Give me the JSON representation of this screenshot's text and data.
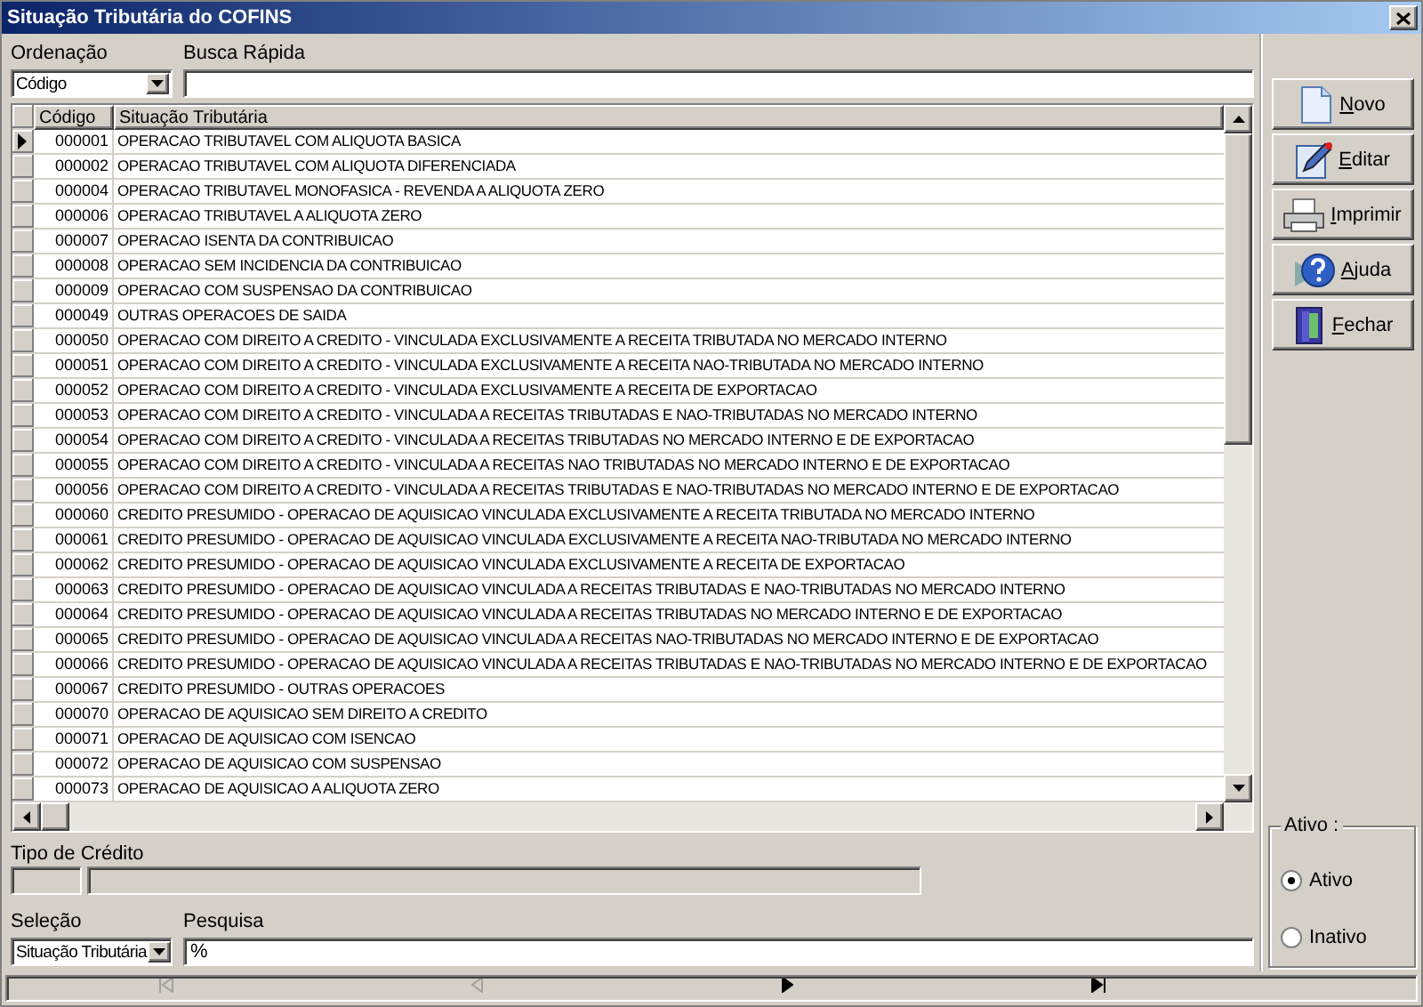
{
  "window": {
    "title": "Situação Tributária do COFINS"
  },
  "ordenacao": {
    "label": "Ordenação",
    "value": "Código"
  },
  "busca_rapida": {
    "label": "Busca Rápida"
  },
  "table": {
    "columns": [
      "Código",
      "Situação Tributária"
    ],
    "rows": [
      {
        "codigo": "000001",
        "situacao": "OPERACAO TRIBUTAVEL COM ALIQUOTA BASICA",
        "selected": true
      },
      {
        "codigo": "000002",
        "situacao": "OPERACAO TRIBUTAVEL COM ALIQUOTA DIFERENCIADA",
        "selected": false
      },
      {
        "codigo": "000004",
        "situacao": "OPERACAO TRIBUTAVEL MONOFASICA - REVENDA A ALIQUOTA ZERO",
        "selected": false
      },
      {
        "codigo": "000006",
        "situacao": "OPERACAO TRIBUTAVEL A ALIQUOTA ZERO",
        "selected": false
      },
      {
        "codigo": "000007",
        "situacao": "OPERACAO ISENTA DA CONTRIBUICAO",
        "selected": false
      },
      {
        "codigo": "000008",
        "situacao": "OPERACAO SEM INCIDENCIA DA CONTRIBUICAO",
        "selected": false
      },
      {
        "codigo": "000009",
        "situacao": "OPERACAO COM SUSPENSAO DA CONTRIBUICAO",
        "selected": false
      },
      {
        "codigo": "000049",
        "situacao": "OUTRAS OPERACOES DE SAIDA",
        "selected": false
      },
      {
        "codigo": "000050",
        "situacao": "OPERACAO COM DIREITO A CREDITO - VINCULADA EXCLUSIVAMENTE A RECEITA TRIBUTADA NO MERCADO INTERNO",
        "selected": false
      },
      {
        "codigo": "000051",
        "situacao": "OPERACAO COM DIREITO A CREDITO - VINCULADA EXCLUSIVAMENTE A RECEITA NAO-TRIBUTADA NO MERCADO INTERNO",
        "selected": false
      },
      {
        "codigo": "000052",
        "situacao": "OPERACAO COM DIREITO A CREDITO - VINCULADA EXCLUSIVAMENTE A RECEITA DE EXPORTACAO",
        "selected": false
      },
      {
        "codigo": "000053",
        "situacao": "OPERACAO COM DIREITO A CREDITO - VINCULADA A RECEITAS TRIBUTADAS E NAO-TRIBUTADAS NO MERCADO INTERNO",
        "selected": false
      },
      {
        "codigo": "000054",
        "situacao": "OPERACAO COM DIREITO A CREDITO - VINCULADA A RECEITAS TRIBUTADAS NO MERCADO INTERNO E DE EXPORTACAO",
        "selected": false
      },
      {
        "codigo": "000055",
        "situacao": "OPERACAO COM DIREITO A CREDITO - VINCULADA A RECEITAS NAO TRIBUTADAS NO MERCADO INTERNO E DE EXPORTACAO",
        "selected": false
      },
      {
        "codigo": "000056",
        "situacao": "OPERACAO COM DIREITO A CREDITO - VINCULADA A RECEITAS TRIBUTADAS E NAO-TRIBUTADAS NO MERCADO INTERNO E DE EXPORTACAO",
        "selected": false
      },
      {
        "codigo": "000060",
        "situacao": "CREDITO PRESUMIDO - OPERACAO DE AQUISICAO VINCULADA EXCLUSIVAMENTE A RECEITA TRIBUTADA NO MERCADO INTERNO",
        "selected": false
      },
      {
        "codigo": "000061",
        "situacao": "CREDITO PRESUMIDO - OPERACAO DE AQUISICAO VINCULADA EXCLUSIVAMENTE A RECEITA NAO-TRIBUTADA NO MERCADO INTERNO",
        "selected": false
      },
      {
        "codigo": "000062",
        "situacao": "CREDITO PRESUMIDO - OPERACAO DE AQUISICAO VINCULADA EXCLUSIVAMENTE A RECEITA DE EXPORTACAO",
        "selected": false
      },
      {
        "codigo": "000063",
        "situacao": "CREDITO PRESUMIDO - OPERACAO DE AQUISICAO VINCULADA A RECEITAS TRIBUTADAS E NAO-TRIBUTADAS NO MERCADO INTERNO",
        "selected": false
      },
      {
        "codigo": "000064",
        "situacao": "CREDITO PRESUMIDO - OPERACAO DE AQUISICAO VINCULADA A RECEITAS TRIBUTADAS NO MERCADO INTERNO E DE EXPORTACAO",
        "selected": false
      },
      {
        "codigo": "000065",
        "situacao": "CREDITO PRESUMIDO - OPERACAO DE AQUISICAO VINCULADA A RECEITAS NAO-TRIBUTADAS NO MERCADO INTERNO E DE EXPORTACAO",
        "selected": false
      },
      {
        "codigo": "000066",
        "situacao": "CREDITO PRESUMIDO - OPERACAO DE AQUISICAO VINCULADA A RECEITAS TRIBUTADAS E NAO-TRIBUTADAS NO MERCADO INTERNO E DE EXPORTACAO",
        "selected": false
      },
      {
        "codigo": "000067",
        "situacao": "CREDITO PRESUMIDO - OUTRAS OPERACOES",
        "selected": false
      },
      {
        "codigo": "000070",
        "situacao": "OPERACAO DE AQUISICAO SEM DIREITO A CREDITO",
        "selected": false
      },
      {
        "codigo": "000071",
        "situacao": "OPERACAO DE AQUISICAO COM ISENCAO",
        "selected": false
      },
      {
        "codigo": "000072",
        "situacao": "OPERACAO DE AQUISICAO COM SUSPENSAO",
        "selected": false
      },
      {
        "codigo": "000073",
        "situacao": "OPERACAO DE AQUISICAO A ALIQUOTA ZERO",
        "selected": false
      }
    ]
  },
  "buttons": [
    {
      "label": "Novo",
      "kind": "new"
    },
    {
      "label": "Editar",
      "kind": "edit"
    },
    {
      "label": "Imprimir",
      "kind": "print"
    },
    {
      "label": "Ajuda",
      "kind": "help"
    },
    {
      "label": "Fechar",
      "kind": "close"
    }
  ],
  "tipo_de_credito": {
    "label": "Tipo de Crédito"
  },
  "selecao": {
    "label": "Seleção",
    "value": "Situação Tributária"
  },
  "pesquisa": {
    "label": "Pesquisa",
    "value": "%"
  },
  "navigator": [
    {
      "kind": "first",
      "disabled": true
    },
    {
      "kind": "prior",
      "disabled": true
    },
    {
      "kind": "next",
      "disabled": false
    },
    {
      "kind": "last",
      "disabled": false
    }
  ],
  "ativo": {
    "title": "Ativo :",
    "options": [
      {
        "label": "Ativo",
        "selected": true
      },
      {
        "label": "Inativo",
        "selected": false
      }
    ]
  }
}
